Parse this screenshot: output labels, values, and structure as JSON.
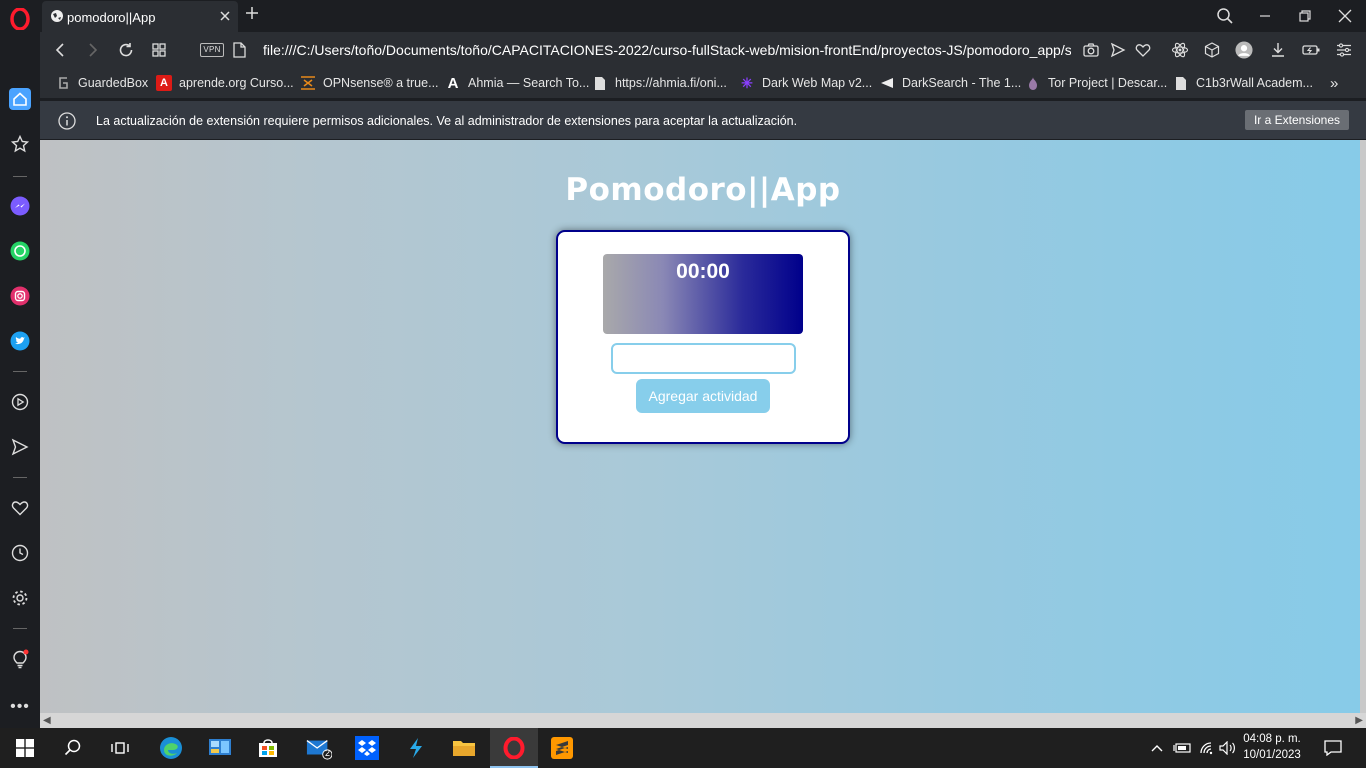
{
  "tab": {
    "title": "pomodoro||App"
  },
  "address_bar": {
    "vpn_label": "VPN",
    "url": "file:///C:/Users/toño/Documents/toño/CAPACITACIONES-2022/curso-fullStack-web/mision-frontEnd/proyectos-JS/pomodoro_app/src/index.html"
  },
  "bookmarks": [
    {
      "label": "GuardedBox",
      "icon": "guardedbox-icon"
    },
    {
      "label": "aprende.org Curso...",
      "icon": "angular-icon"
    },
    {
      "label": "OPNsense® a true...",
      "icon": "opnsense-icon"
    },
    {
      "label": "Ahmia — Search To...",
      "icon": "ahmia-icon"
    },
    {
      "label": "https://ahmia.fi/oni...",
      "icon": "page-icon"
    },
    {
      "label": "Dark Web Map v2...",
      "icon": "star-icon"
    },
    {
      "label": "DarkSearch - The 1...",
      "icon": "arrow-left-icon"
    },
    {
      "label": "Tor Project | Descar...",
      "icon": "onion-icon"
    },
    {
      "label": "C1b3rWall Academ...",
      "icon": "page-icon"
    }
  ],
  "infobar": {
    "message": "La actualización de extensión requiere permisos adicionales. Ve al administrador de extensiones para aceptar la actualización.",
    "button_label": "Ir a Extensiones"
  },
  "page": {
    "title": "Pomodoro||App",
    "timer": "00:00",
    "task_input_value": "",
    "add_button_label": "Agregar actividad"
  },
  "taskbar": {
    "mail_badge": "2",
    "time": "04:08 p. m.",
    "date": "10/01/2023"
  },
  "colors": {
    "accent_border": "#00008b",
    "button_bg": "#87ceeb",
    "timer_gradient_end": "#00008b"
  }
}
